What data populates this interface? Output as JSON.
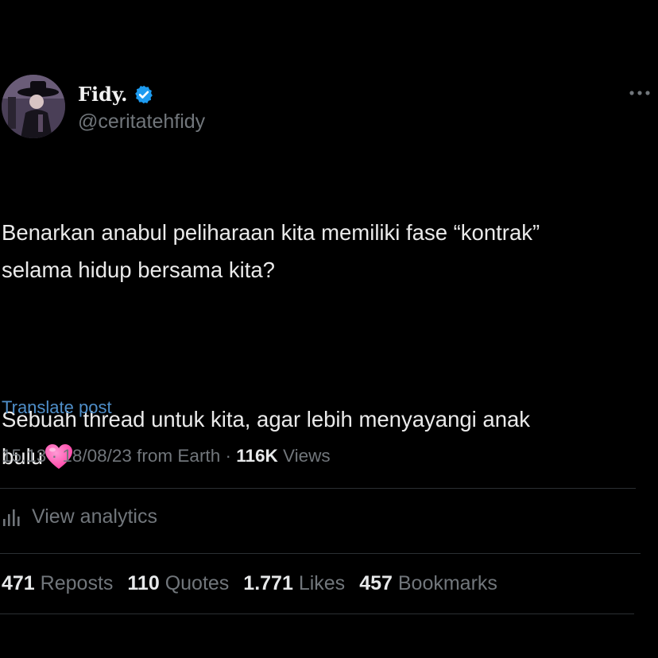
{
  "author": {
    "display_name": "Fidy.",
    "handle": "@ceritatehfidy",
    "verified_icon": "verified-badge-icon",
    "accent": "#1d9bf0"
  },
  "post": {
    "text_p1": "Benarkan anabul peliharaan kita memiliki fase “kontrak”\nselama hidup bersama kita?",
    "text_p2": "Sebuah thread untuk kita, agar lebih menyayangi anak\nbulu",
    "emoji_icon": "pink-heart-icon"
  },
  "translate_label": "Translate post",
  "meta": {
    "time": "15.13",
    "date": "18/08/23",
    "location": "from Earth",
    "views_count": "116K",
    "views_label": "Views"
  },
  "analytics_label": "View analytics",
  "stats": {
    "reposts_count": "471",
    "reposts_label": "Reposts",
    "quotes_count": "110",
    "quotes_label": "Quotes",
    "likes_count": "1.771",
    "likes_label": "Likes",
    "bookmarks_count": "457",
    "bookmarks_label": "Bookmarks"
  }
}
